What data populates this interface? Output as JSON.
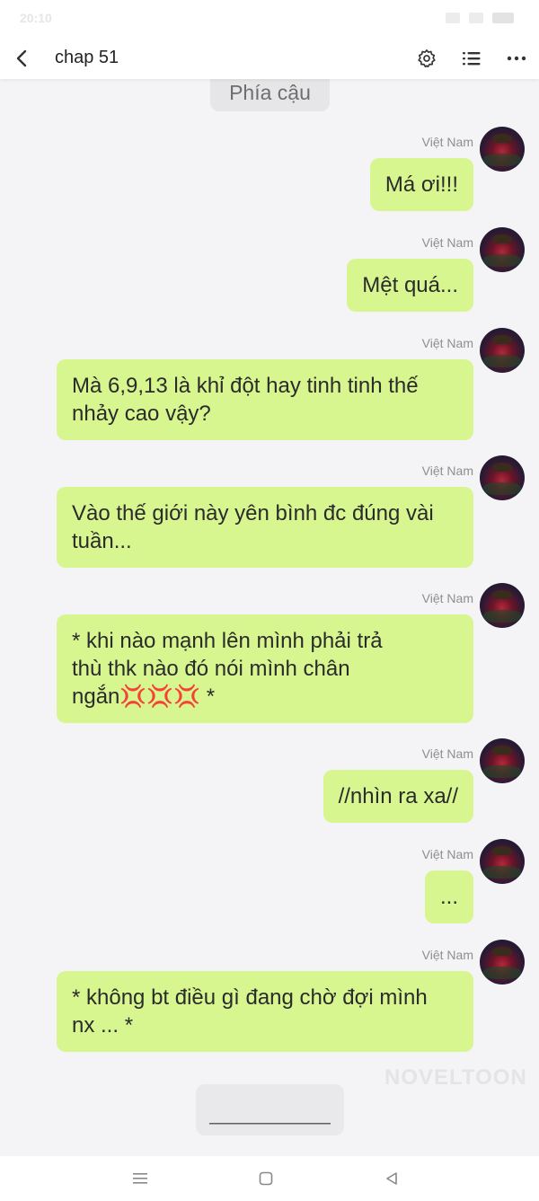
{
  "status_bar": {
    "time": "20:10"
  },
  "header": {
    "title": "chap 51"
  },
  "top_bubble": {
    "text": "Phía cậu"
  },
  "sender": "Việt Nam",
  "messages": [
    {
      "text": "Má ơi!!!"
    },
    {
      "text": "Mệt quá..."
    },
    {
      "text": "Mà 6,9,13 là khỉ đột hay tinh tinh thế\nnhảy cao vậy?"
    },
    {
      "text": "Vào thế giới này yên bình đc đúng vài\ntuần..."
    },
    {
      "text": "* khi nào mạnh lên mình phải trả\nthù thk nào đó nói mình chân\nngắn💢💢💢 *"
    },
    {
      "text": "//nhìn ra xa//"
    },
    {
      "text": "..."
    },
    {
      "text": "* không bt điều gì đang chờ đợi mình\nnx ... *"
    }
  ],
  "watermark": "NOVELTOON",
  "input": {
    "text": "___________"
  },
  "colors": {
    "bubble": "#d8f68f",
    "background": "#f4f4f6"
  }
}
